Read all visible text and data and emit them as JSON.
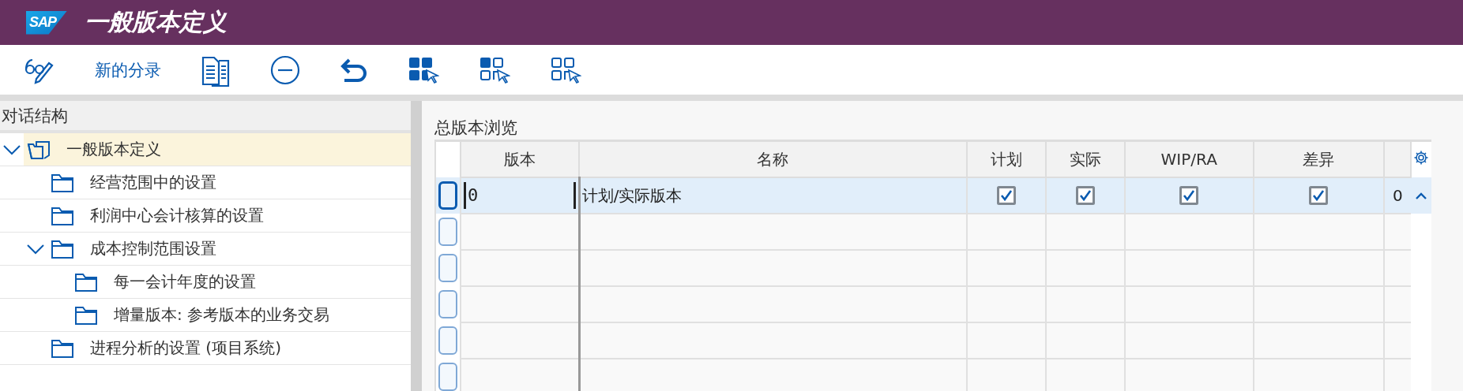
{
  "header": {
    "logo": "SAP",
    "title": "一般版本定义"
  },
  "toolbar": [
    {
      "kind": "icon"
    },
    {
      "kind": "text",
      "label": "新的分录"
    },
    {
      "kind": "icon"
    },
    {
      "kind": "icon"
    },
    {
      "kind": "icon"
    },
    {
      "kind": "icon"
    },
    {
      "kind": "icon"
    },
    {
      "kind": "icon"
    }
  ],
  "dialog_structure": {
    "title": "对话结构",
    "items": [
      {
        "label": "一般版本定义",
        "expanded": true,
        "selected": true,
        "children": [
          {
            "label": "经营范围中的设置",
            "selected": false
          },
          {
            "label": "利润中心会计核算的设置",
            "selected": false
          },
          {
            "label": "成本控制范围设置",
            "expanded": true,
            "selected": false,
            "children": [
              {
                "label": "每一会计年度的设置",
                "selected": false
              },
              {
                "label": "增量版本: 参考版本的业务交易",
                "selected": false
              }
            ]
          },
          {
            "label": "进程分析的设置 (项目系统)",
            "selected": false
          }
        ]
      }
    ]
  },
  "overview": {
    "title": "总版本浏览",
    "columns": [
      "版本",
      "名称",
      "计划",
      "实际",
      "WIP/RA",
      "差异"
    ],
    "rows": [
      {
        "selected": true,
        "version": "0",
        "name": "计划/实际版本",
        "plan": true,
        "actual": true,
        "wip_ra": true,
        "variance": true
      }
    ],
    "row_count": "0"
  }
}
